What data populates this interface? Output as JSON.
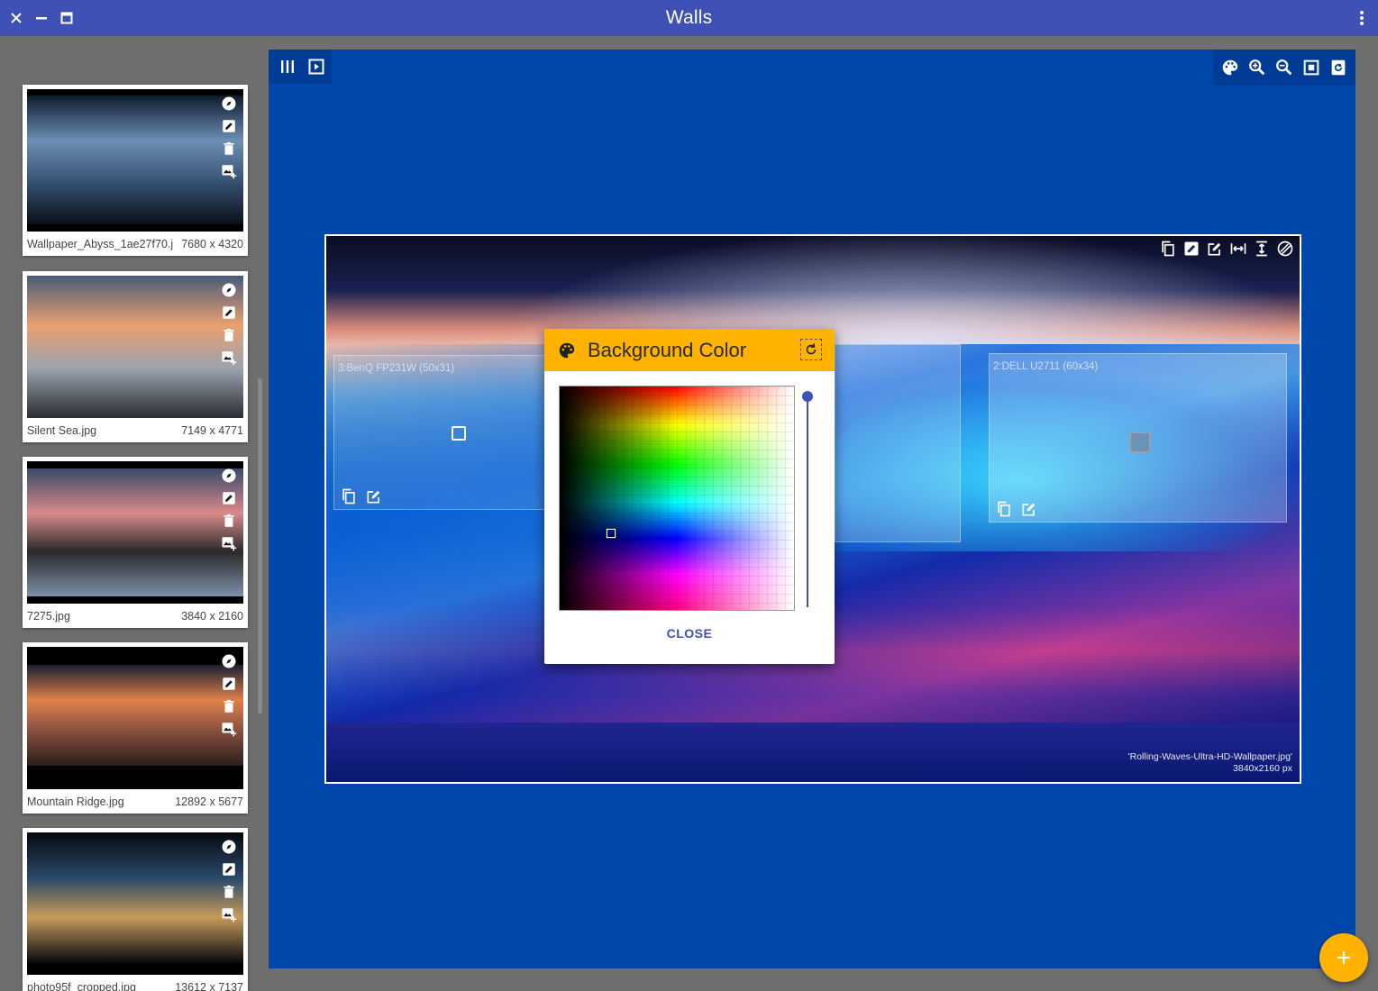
{
  "window": {
    "title": "Walls"
  },
  "sidebar": {
    "items": [
      {
        "filename": "Wallpaper_Abyss_1ae27f70.j",
        "dimensions": "7680 x 4320",
        "thumb_colors": [
          "#0d1b2e",
          "#6d8fb3",
          "#3a5677",
          "#0a0f1a"
        ]
      },
      {
        "filename": "Silent Sea.jpg",
        "dimensions": "7149 x 4771",
        "thumb_colors": [
          "#4a5a78",
          "#e9a070",
          "#9ba3ad",
          "#2a2d33"
        ]
      },
      {
        "filename": "7275.jpg",
        "dimensions": "3840 x 2160",
        "thumb_colors": [
          "#3b4a6a",
          "#d88a8a",
          "#2a2a2a",
          "#7d8fa8"
        ]
      },
      {
        "filename": "Mountain Ridge.jpg",
        "dimensions": "12892 x 5677",
        "thumb_colors": [
          "#1a2030",
          "#e0804a",
          "#8a5040",
          "#2a1e1a"
        ]
      },
      {
        "filename": "photo95f_cropped.jpg",
        "dimensions": "13612 x 7137",
        "thumb_colors": [
          "#05080f",
          "#2a4a6a",
          "#c89a5a",
          "#05080f"
        ]
      }
    ]
  },
  "canvas": {
    "image_name": "'Rolling-Waves-Ultra-HD-Wallpaper.jpg'",
    "image_size": "3840x2160 px",
    "monitors": [
      {
        "label": "3:BenQ FP231W (50x31)"
      },
      {
        "label": "2:DELL U2711 (60x34)"
      }
    ]
  },
  "dialog": {
    "title": "Background Color",
    "close_label": "CLOSE",
    "selected_color": "#1f5fcf"
  },
  "colors": {
    "accent": "#3f51b5",
    "amber": "#ffb300",
    "workspace": "#0047ab"
  },
  "icons": {
    "titlebar": [
      "close-icon",
      "minimize-icon",
      "maximize-icon",
      "more-vert-icon"
    ],
    "main_toolbar_left": [
      "columns-icon",
      "slideshow-icon"
    ],
    "main_toolbar_right": [
      "palette-icon",
      "zoom-in-icon",
      "zoom-out-icon",
      "fit-screen-icon",
      "reset-icon"
    ],
    "card_tools": [
      "compass-icon",
      "edit-image-icon",
      "delete-icon",
      "add-image-icon"
    ],
    "canvas_tools": [
      "copy-icon",
      "edit-image-icon",
      "edit-icon",
      "fit-width-icon",
      "fit-height-icon",
      "rotate-icon"
    ]
  }
}
